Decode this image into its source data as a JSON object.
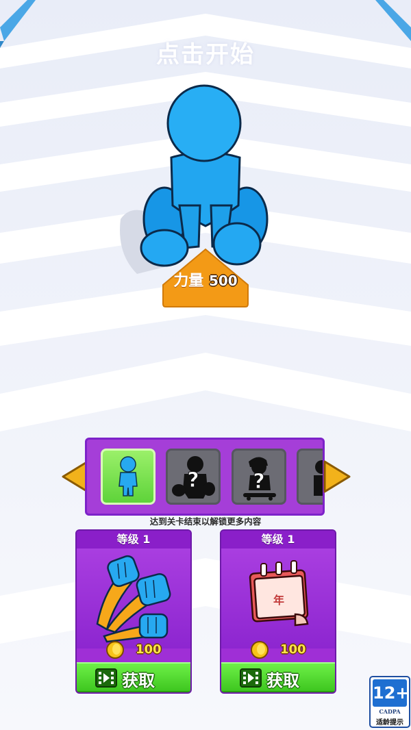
{
  "title": "点击开始",
  "player": {
    "power_label": "力量",
    "power_value": "500"
  },
  "skins": {
    "unlock_hint": "达到关卡结束以解锁更多内容",
    "slots": [
      {
        "state": "selected"
      },
      {
        "state": "locked",
        "mark": "?"
      },
      {
        "state": "locked",
        "mark": "?"
      },
      {
        "state": "locked"
      }
    ]
  },
  "upgrades": [
    {
      "level_label": "等级 1",
      "price": "100",
      "button_label": "获取",
      "icon": "fists-icon"
    },
    {
      "level_label": "等级 1",
      "price": "100",
      "button_label": "获取",
      "icon": "calendar-icon",
      "icon_text": "年"
    }
  ],
  "age_rating": {
    "rating": "12+",
    "org": "CADPA",
    "tip": "适龄提示"
  },
  "colors": {
    "player": "#1ea8f2",
    "panel": "#a53ed8",
    "button": "#4fd92e",
    "badge": "#f39a16"
  }
}
